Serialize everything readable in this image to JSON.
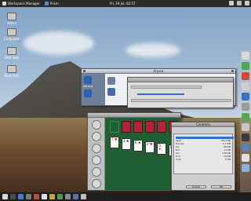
{
  "top_panel": {
    "menu_label": "Workspace Manager",
    "app_label": "Prism",
    "clock": "Fri, 19 Jul, 02:57"
  },
  "desktop_icons": [
    {
      "label": "Home"
    },
    {
      "label": "Computer"
    },
    {
      "label": "DVD Disk"
    },
    {
      "label": "Root Disk"
    }
  ],
  "windows": {
    "arjuna": {
      "title": "Arjuna"
    },
    "solitaire": {
      "title": ""
    },
    "info": {
      "title": "Contents"
    }
  },
  "arjuna_side": {
    "label_top": "IDE Disk",
    "label_bottom": "Root Dsk"
  },
  "solitaire": {
    "cards": [
      {
        "rank": "7",
        "suit": "♥",
        "red": true
      },
      {
        "rank": "2",
        "suit": "♠",
        "red": false
      },
      {
        "rank": "6",
        "suit": "♠",
        "red": false
      },
      {
        "rank": "4",
        "suit": "♥",
        "red": true
      },
      {
        "rank": "Q",
        "suit": "♦",
        "red": true
      },
      {
        "rank": "8",
        "suit": "♠",
        "red": false
      }
    ]
  },
  "info_panel": {
    "rows": [
      [
        "Appl",
        "59.4 KB"
      ],
      [
        "Bundle",
        "1.2 MB"
      ],
      [
        "Src",
        "58 KB"
      ],
      [
        "Doc",
        "14 KB"
      ],
      [
        "Lib",
        "118 KB"
      ],
      [
        "Frm",
        "24 KB"
      ],
      [
        "Tmp",
        "0 KB"
      ]
    ],
    "ok_label": "OK",
    "cancel_label": "Cancel"
  }
}
